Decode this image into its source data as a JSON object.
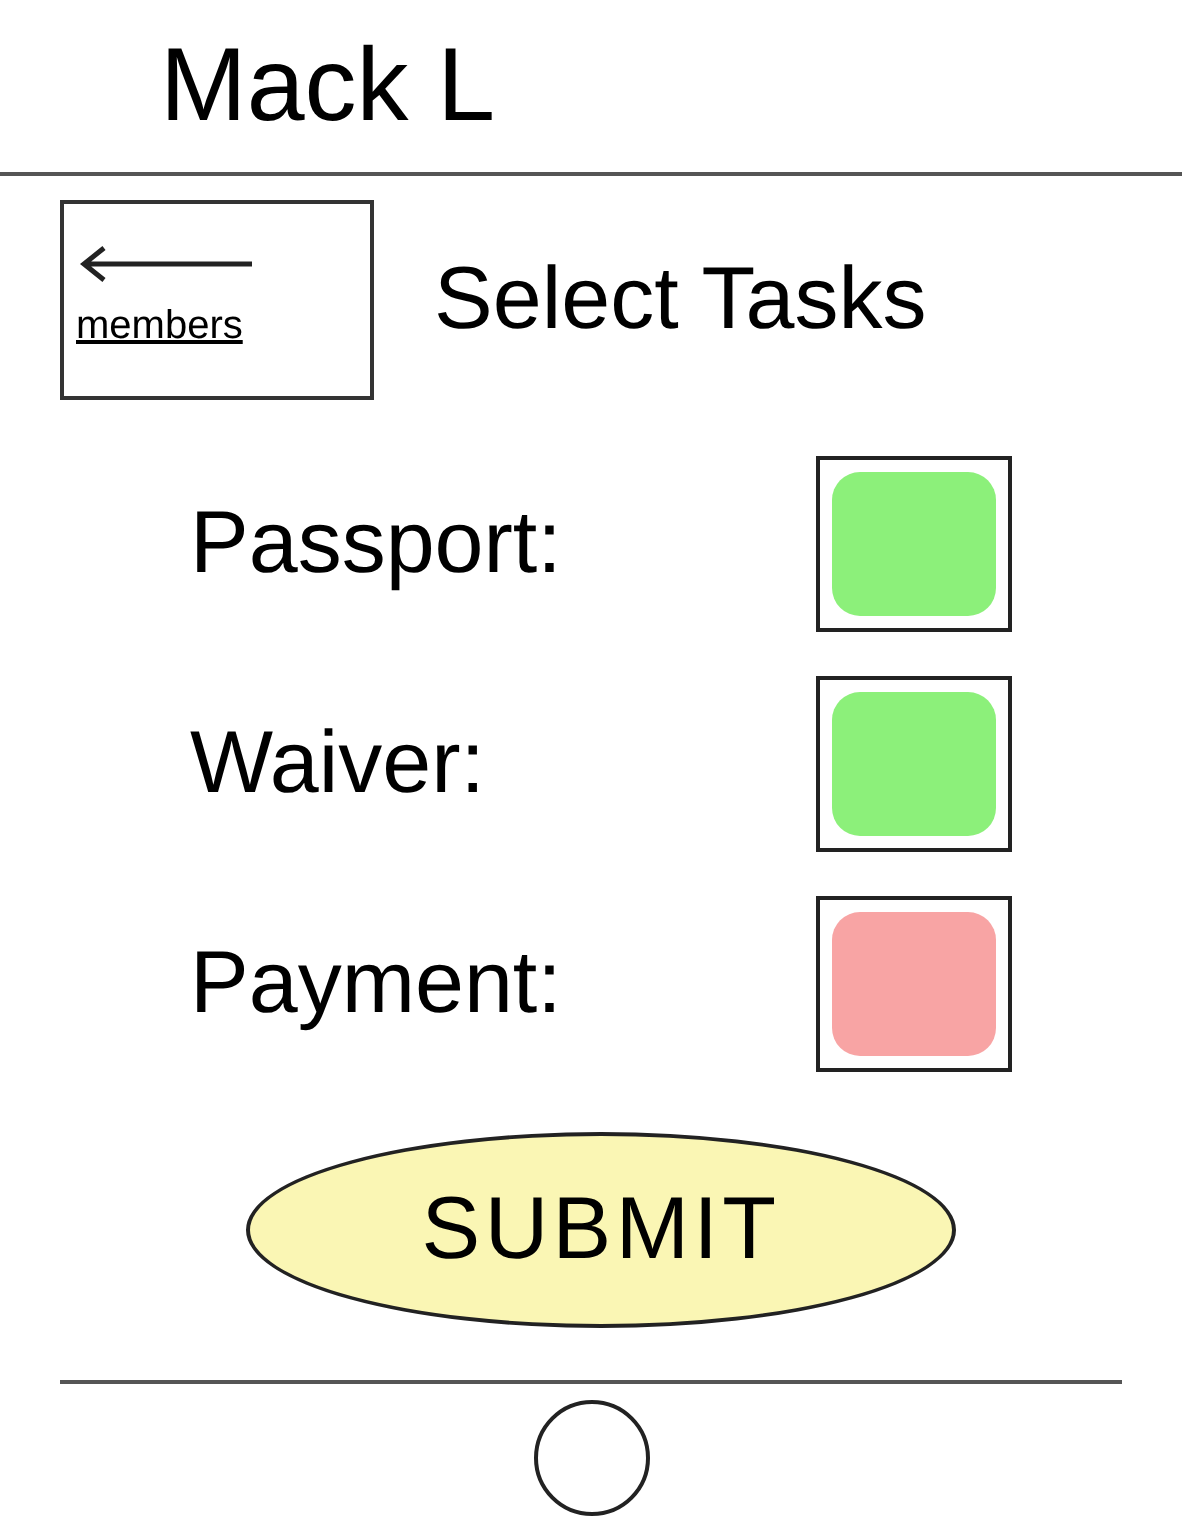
{
  "header": {
    "title": "Mack L"
  },
  "nav": {
    "back_label": "members",
    "title": "Select Tasks"
  },
  "tasks": [
    {
      "label": "Passport:",
      "color": "#8cf07a"
    },
    {
      "label": "Waiver:",
      "color": "#8cf07a"
    },
    {
      "label": "Payment:",
      "color": "#f8a4a4"
    }
  ],
  "submit": {
    "label": "SUBMIT"
  }
}
